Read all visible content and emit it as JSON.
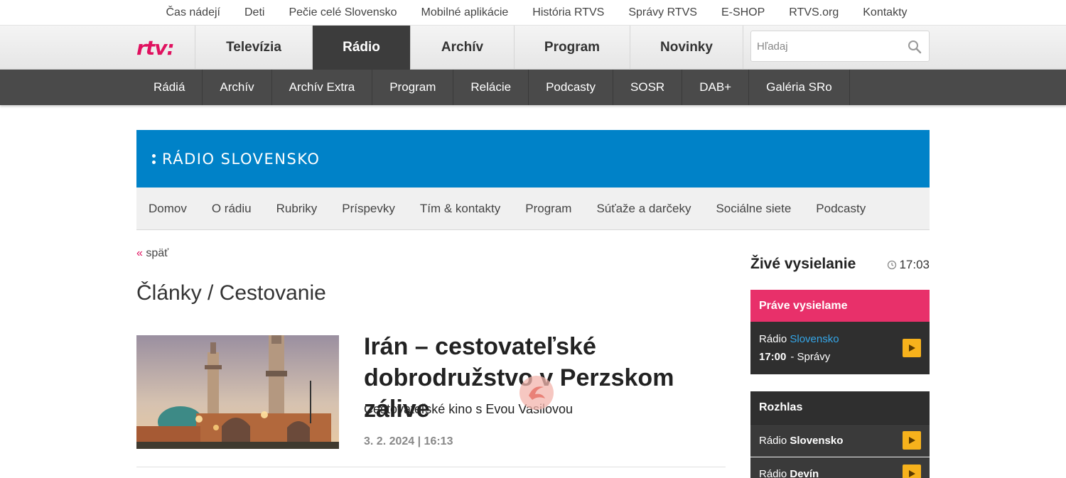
{
  "topbar": {
    "links": [
      "Čas nádejí",
      "Deti",
      "Pečie celé Slovensko",
      "Mobilné aplikácie",
      "História RTVS",
      "Správy RTVS",
      "E-SHOP",
      "RTVS.org",
      "Kontakty"
    ]
  },
  "mainnav": {
    "logo": "rtv:",
    "items": [
      "Televízia",
      "Rádio",
      "Archív",
      "Program",
      "Novinky"
    ],
    "active": "Rádio",
    "search_placeholder": "Hľadaj"
  },
  "subnav": {
    "items": [
      "Rádiá",
      "Archív",
      "Archív Extra",
      "Program",
      "Relácie",
      "Podcasty",
      "SOSR",
      "DAB+",
      "Galéria SRo"
    ]
  },
  "banner": {
    "title": "RÁDIO SLOVENSKO"
  },
  "radionav": {
    "items": [
      "Domov",
      "O rádiu",
      "Rubriky",
      "Príspevky",
      "Tím & kontakty",
      "Program",
      "Súťaže a darčeky",
      "Sociálne siete",
      "Podcasty"
    ]
  },
  "content": {
    "back_arrow": "«",
    "back_label": "späť",
    "heading": "Články / Cestovanie",
    "article": {
      "title": "Irán – cestovateľské dobrodružstvo v Perzskom zálive",
      "subtitle": "Cestovateľské kino s Evou Vasilovou",
      "date": "3. 2. 2024 | 16:13"
    }
  },
  "sidebar": {
    "live_title": "Živé vysielanie",
    "live_time": "17:03",
    "onair_label": "Práve vysielame",
    "onair_station_prefix": "Rádio",
    "onair_station_highlight": "Slovensko",
    "onair_time": "17:00",
    "onair_show": "- Správy",
    "rozhlas_label": "Rozhlas",
    "stations": [
      {
        "prefix": "Rádio",
        "name": "Slovensko"
      },
      {
        "prefix": "Rádio",
        "name": "Devín"
      }
    ]
  },
  "colors": {
    "brand_pink": "#e0115f",
    "radio_blue": "#0082c8",
    "onair_pink": "#e8306a",
    "play_yellow": "#f7b21c"
  }
}
